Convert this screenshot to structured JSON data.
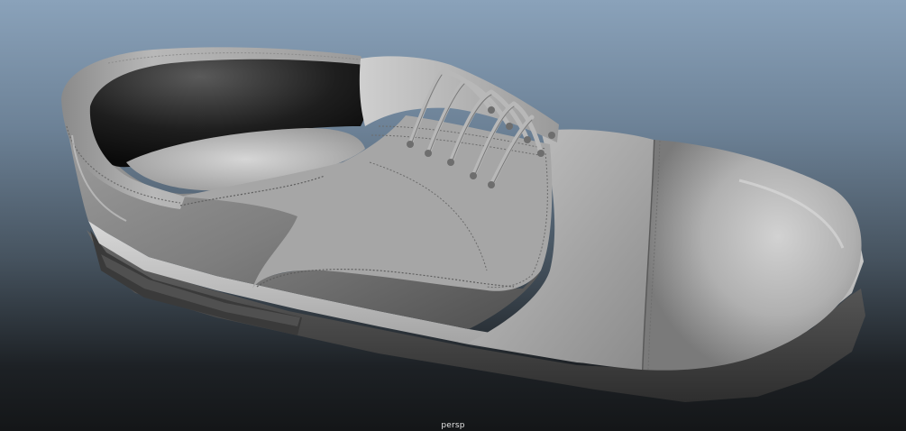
{
  "viewport": {
    "camera_label": "persp",
    "background_top_color": "#8aa2ba",
    "background_bottom_color": "#141618",
    "model_color": "#a4a4a4"
  }
}
